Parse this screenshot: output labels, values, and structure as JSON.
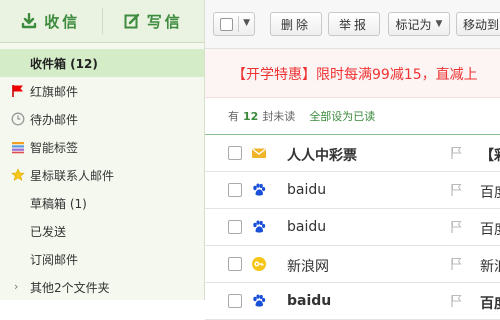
{
  "sidebar": {
    "receive_label": "收信",
    "compose_label": "写信",
    "items": [
      {
        "label": "收件箱 (12)",
        "icon": "inbox"
      },
      {
        "label": "红旗邮件",
        "icon": "red-flag-icon"
      },
      {
        "label": "待办邮件",
        "icon": "clock-icon"
      },
      {
        "label": "智能标签",
        "icon": "tags-icon"
      },
      {
        "label": "星标联系人邮件",
        "icon": "star-icon"
      },
      {
        "label": "草稿箱 (1)",
        "icon": ""
      },
      {
        "label": "已发送",
        "icon": ""
      },
      {
        "label": "订阅邮件",
        "icon": ""
      },
      {
        "label": "其他2个文件夹",
        "icon": "chevron-right-icon"
      }
    ]
  },
  "toolbar": {
    "delete_label": "删除",
    "report_label": "举报",
    "mark_label": "标记为",
    "move_label": "移动到"
  },
  "promo": {
    "text": "【开学特惠】限时每满99减15，直减上"
  },
  "summary": {
    "prefix": "有",
    "count": "12",
    "suffix": "封未读",
    "mark_all_label": "全部设为已读"
  },
  "emails": [
    {
      "sender": "人人中彩票",
      "subject": "【彩",
      "unread": true,
      "icon": "envelope-icon"
    },
    {
      "sender": "baidu",
      "subject": "百度",
      "unread": false,
      "icon": "paw-icon"
    },
    {
      "sender": "baidu",
      "subject": "百度",
      "unread": false,
      "icon": "paw-icon"
    },
    {
      "sender": "新浪网",
      "subject": "新浪",
      "unread": false,
      "icon": "key-icon"
    },
    {
      "sender": "baidu",
      "subject": "百度",
      "unread": true,
      "icon": "paw-icon"
    }
  ],
  "colors": {
    "brand_green": "#3d8b3d",
    "active_bg": "#d4ecc8",
    "promo_red": "#e33333"
  }
}
